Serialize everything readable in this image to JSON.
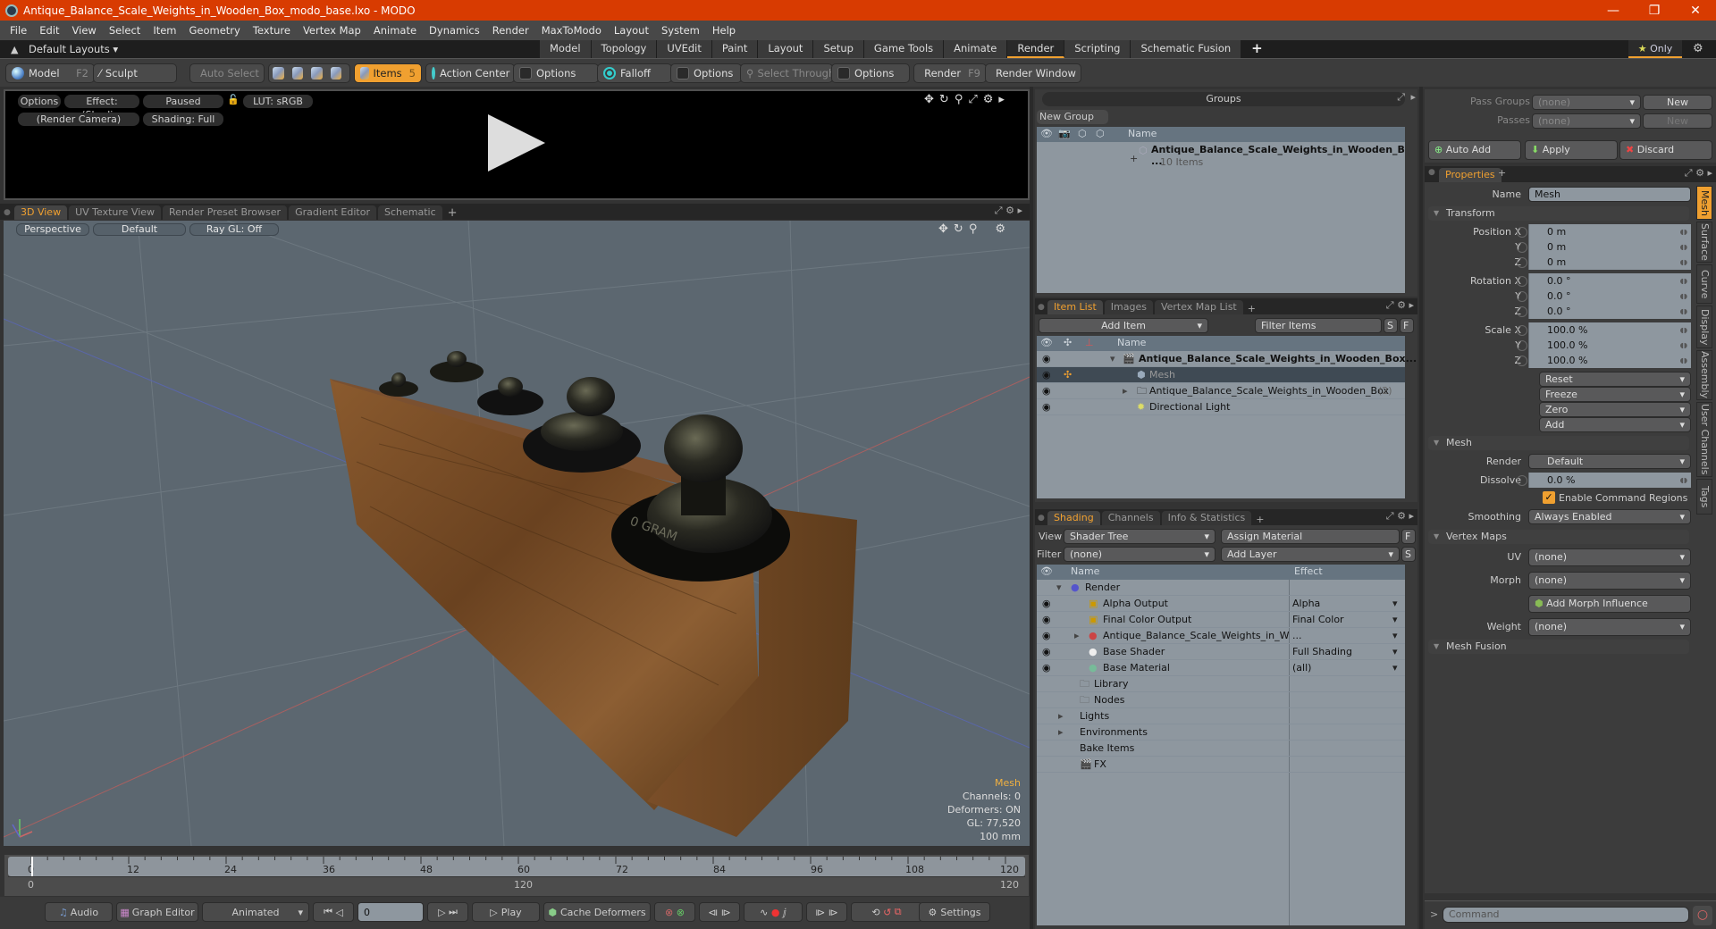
{
  "window": {
    "title": "Antique_Balance_Scale_Weights_in_Wooden_Box_modo_base.lxo - MODO",
    "minimize": "—",
    "restore": "❐",
    "close": "✕"
  },
  "menu": [
    "File",
    "Edit",
    "View",
    "Select",
    "Item",
    "Geometry",
    "Texture",
    "Vertex Map",
    "Animate",
    "Dynamics",
    "Render",
    "MaxToModo",
    "Layout",
    "System",
    "Help"
  ],
  "layoutbar": {
    "default_layouts": "Default Layouts ▾",
    "tabs": [
      "Model",
      "Topology",
      "UVEdit",
      "Paint",
      "Layout",
      "Setup",
      "Game Tools",
      "Animate",
      "Render",
      "Scripting",
      "Schematic Fusion"
    ],
    "active_tab": "Render",
    "add": "+",
    "only": "Only"
  },
  "toolbar": {
    "model": "Model",
    "model_key": "F2",
    "sculpt": "Sculpt",
    "auto_select": "Auto Select",
    "items": "Items",
    "items_key": "5",
    "action_center": "Action Center",
    "options1": "Options",
    "falloff": "Falloff",
    "options2": "Options",
    "select_through": "Select Through",
    "options3": "Options",
    "render": "Render",
    "render_key": "F9",
    "render_window": "Render Window"
  },
  "render_preview": {
    "options": "Options",
    "effect": "Effect: (Shadi...",
    "paused": "Paused",
    "lut": "LUT: sRGB",
    "camera": "(Render Camera)",
    "shading": "Shading: Full"
  },
  "viewport": {
    "tabs": [
      "3D View",
      "UV Texture View",
      "Render Preset Browser",
      "Gradient Editor",
      "Schematic"
    ],
    "active_tab": "3D View",
    "projection": "Perspective",
    "style": "Default",
    "raygl": "Ray GL: Off",
    "info": {
      "selection": "Mesh",
      "channels": "Channels: 0",
      "deformers": "Deformers: ON",
      "gl": "GL: 77,520",
      "scale": "100 mm"
    },
    "model_label": "0 GRAM"
  },
  "timeline": {
    "ticks": [
      "0",
      "12",
      "24",
      "36",
      "48",
      "60",
      "72",
      "84",
      "96",
      "108",
      "120"
    ],
    "range_start": "0",
    "range_mid": "120",
    "range_end": "120"
  },
  "transport": {
    "audio": "Audio",
    "graph_editor": "Graph Editor",
    "mode": "Animated",
    "frame": "0",
    "play": "Play",
    "cache_deformers": "Cache Deformers",
    "settings": "Settings"
  },
  "groups": {
    "title": "Groups",
    "new_group": "New Group",
    "col_name": "Name",
    "rows": [
      {
        "name": "Antique_Balance_Scale_Weights_in_Wooden_B ...",
        "sub": "10 Items"
      }
    ]
  },
  "itemlist": {
    "tabs": [
      "Item List",
      "Images",
      "Vertex Map List"
    ],
    "active_tab": "Item List",
    "add_item": "Add Item",
    "filter_placeholder": "Filter Items",
    "s": "S",
    "f": "F",
    "col_name": "Name",
    "rows": [
      {
        "name": "Antique_Balance_Scale_Weights_in_Wooden_Box...",
        "bold": true
      },
      {
        "name": "Mesh",
        "selected": true
      },
      {
        "name": "Antique_Balance_Scale_Weights_in_Wooden_Box",
        "count": "(2)"
      },
      {
        "name": "Directional Light"
      }
    ]
  },
  "shading": {
    "tabs": [
      "Shading",
      "Channels",
      "Info & Statistics"
    ],
    "active_tab": "Shading",
    "view_label": "View",
    "view_value": "Shader Tree",
    "assign_material": "Assign Material",
    "f": "F",
    "filter_label": "Filter",
    "filter_value": "(none)",
    "add_layer": "Add Layer",
    "s": "S",
    "col_name": "Name",
    "col_effect": "Effect",
    "rows": [
      {
        "name": "Render",
        "effect": ""
      },
      {
        "name": "Alpha Output",
        "effect": "Alpha"
      },
      {
        "name": "Final Color Output",
        "effect": "Final Color"
      },
      {
        "name": "Antique_Balance_Scale_Weights_in_W ...",
        "effect": ""
      },
      {
        "name": "Base Shader",
        "effect": "Full Shading"
      },
      {
        "name": "Base Material",
        "effect": "(all)"
      },
      {
        "name": "Library",
        "effect": ""
      },
      {
        "name": "Nodes",
        "effect": ""
      },
      {
        "name": "Lights",
        "effect": ""
      },
      {
        "name": "Environments",
        "effect": ""
      },
      {
        "name": "Bake Items",
        "effect": ""
      },
      {
        "name": "FX",
        "effect": ""
      }
    ]
  },
  "passes": {
    "pass_groups_label": "Pass Groups",
    "pass_groups_value": "(none)",
    "passes_label": "Passes",
    "passes_value": "(none)",
    "new": "New",
    "auto_add": "Auto Add",
    "apply": "Apply",
    "discard": "Discard"
  },
  "properties": {
    "tab": "Properties",
    "name_label": "Name",
    "name_value": "Mesh",
    "transform": "Transform",
    "position": {
      "label": "Position X",
      "x": "0 m",
      "y": "0 m",
      "z": "0 m"
    },
    "rotation": {
      "label": "Rotation X",
      "x": "0.0 °",
      "y": "0.0 °",
      "z": "0.0 °"
    },
    "scale": {
      "label": "Scale X",
      "x": "100.0 %",
      "y": "100.0 %",
      "z": "100.0 %"
    },
    "axis": {
      "y": "Y",
      "z": "Z"
    },
    "actions": [
      "Reset",
      "Freeze",
      "Zero",
      "Add"
    ],
    "mesh": "Mesh",
    "render_label": "Render",
    "render_value": "Default",
    "dissolve_label": "Dissolve",
    "dissolve_value": "0.0 %",
    "enable_command_regions": "Enable Command Regions",
    "smoothing_label": "Smoothing",
    "smoothing_value": "Always Enabled",
    "vertex_maps": "Vertex Maps",
    "uv_label": "UV",
    "uv_value": "(none)",
    "morph_label": "Morph",
    "morph_value": "(none)",
    "add_morph": "Add Morph Influence",
    "weight_label": "Weight",
    "weight_value": "(none)",
    "mesh_fusion": "Mesh Fusion",
    "side_tabs": [
      "Mesh",
      "Surface",
      "Curve",
      "Display",
      "Assembly",
      "User Channels",
      "Tags"
    ]
  },
  "command": {
    "prompt": ">",
    "placeholder": "Command"
  }
}
